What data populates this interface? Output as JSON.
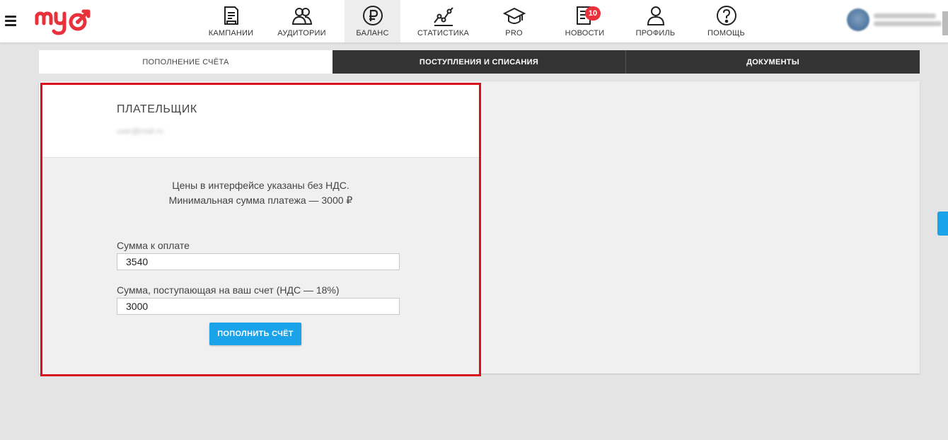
{
  "brand": {
    "logo_text": "myTarget",
    "accent": "#e8313a",
    "blue": "#1aa3e8"
  },
  "nav": {
    "items": [
      {
        "label": "КАМПАНИИ",
        "icon": "campaigns-icon"
      },
      {
        "label": "АУДИТОРИИ",
        "icon": "audiences-icon"
      },
      {
        "label": "БАЛАНС",
        "icon": "ruble-icon",
        "active": true
      },
      {
        "label": "СТАТИСТИКА",
        "icon": "statistics-icon"
      },
      {
        "label": "PRO",
        "icon": "graduation-cap-icon"
      },
      {
        "label": "НОВОСТИ",
        "icon": "news-icon",
        "badge": "10"
      },
      {
        "label": "ПРОФИЛЬ",
        "icon": "profile-icon"
      },
      {
        "label": "ПОМОЩЬ",
        "icon": "help-icon"
      }
    ]
  },
  "tabs": [
    {
      "label": "ПОПОЛНЕНИЕ СЧЁТА",
      "active": true
    },
    {
      "label": "ПОСТУПЛЕНИЯ И СПИСАНИЯ"
    },
    {
      "label": "ДОКУМЕНТЫ"
    }
  ],
  "payer": {
    "title": "ПЛАТЕЛЬЩИК",
    "email": "user@mail.ru"
  },
  "info": {
    "line1": "Цены в интерфейсе указаны без НДС.",
    "line2": "Минимальная сумма платежа — 3000 ₽"
  },
  "form": {
    "amount_label": "Сумма к оплате",
    "amount_value": "3540",
    "net_label": "Сумма, поступающая на ваш счет (НДС — 18%)",
    "net_value": "3000",
    "submit_label": "ПОПОЛНИТЬ СЧЁТ"
  }
}
